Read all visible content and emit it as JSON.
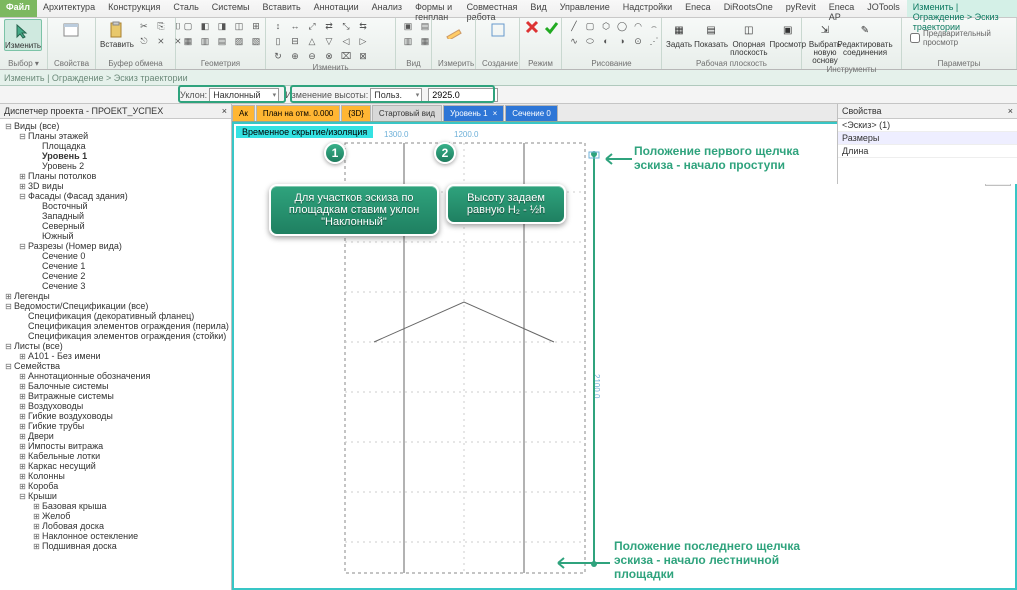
{
  "tabs": {
    "file": "Файл",
    "list": [
      "Архитектура",
      "Конструкция",
      "Сталь",
      "Системы",
      "Вставить",
      "Аннотации",
      "Анализ",
      "Формы и генплан",
      "Совместная работа",
      "Вид",
      "Управление",
      "Надстройки",
      "Eneca",
      "DiRootsOne",
      "pyRevit",
      "Eneca AP",
      "JOTools"
    ],
    "active": "Изменить | Ограждение > Эскиз траектории"
  },
  "ribbon": {
    "select": "Выбор ▾",
    "modify": "Изменить",
    "properties": "Свойства",
    "clipboard": "Буфер обмена",
    "paste": "Вставить",
    "geometry": "Геометрия",
    "modify_panel": "Изменить",
    "view": "Вид",
    "measure": "Измерить",
    "create": "Создание",
    "mode_panel": "Режим",
    "draw": "Рисование",
    "workplane": "Рабочая плоскость",
    "tools": "Инструменты",
    "options": "Параметры",
    "set": "Задать",
    "show": "Показать",
    "refplane": "Опорная плоскость",
    "viewer": "Просмотр",
    "pickhost": "Выбрать новую основу",
    "edit": "Редактировать соединения",
    "preview_chk": "Предварительный просмотр"
  },
  "optbar": {
    "text": "Изменить | Ограждение > Эскиз траектории"
  },
  "optbar2": {
    "slope_lbl": "Уклон:",
    "slope_val": "Наклонный",
    "height_lbl": "Изменение высоты:",
    "height_val": "Польз.",
    "height_num": "2925.0"
  },
  "browser": {
    "title": "Диспетчер проекта - ПРОЕКТ_УСПЕХ",
    "close": "×",
    "items": [
      {
        "d": 0,
        "t": "⊟",
        "l": "Виды (все)",
        "ic": "v"
      },
      {
        "d": 1,
        "t": "⊟",
        "l": "Планы этажей"
      },
      {
        "d": 2,
        "t": "",
        "l": "Площадка"
      },
      {
        "d": 2,
        "t": "",
        "l": "Уровень 1",
        "b": 1
      },
      {
        "d": 2,
        "t": "",
        "l": "Уровень 2"
      },
      {
        "d": 1,
        "t": "⊞",
        "l": "Планы потолков"
      },
      {
        "d": 1,
        "t": "⊞",
        "l": "3D виды"
      },
      {
        "d": 1,
        "t": "⊟",
        "l": "Фасады (Фасад здания)"
      },
      {
        "d": 2,
        "t": "",
        "l": "Восточный"
      },
      {
        "d": 2,
        "t": "",
        "l": "Западный"
      },
      {
        "d": 2,
        "t": "",
        "l": "Северный"
      },
      {
        "d": 2,
        "t": "",
        "l": "Южный"
      },
      {
        "d": 1,
        "t": "⊟",
        "l": "Разрезы (Номер вида)"
      },
      {
        "d": 2,
        "t": "",
        "l": "Сечение 0"
      },
      {
        "d": 2,
        "t": "",
        "l": "Сечение 1"
      },
      {
        "d": 2,
        "t": "",
        "l": "Сечение 2"
      },
      {
        "d": 2,
        "t": "",
        "l": "Сечение 3"
      },
      {
        "d": 0,
        "t": "⊞",
        "l": "Легенды",
        "ic": "l"
      },
      {
        "d": 0,
        "t": "⊟",
        "l": "Ведомости/Спецификации (все)",
        "ic": "s"
      },
      {
        "d": 1,
        "t": "",
        "l": "Спецификация (декоративный фланец)"
      },
      {
        "d": 1,
        "t": "",
        "l": "Спецификация элементов ограждения (перила)"
      },
      {
        "d": 1,
        "t": "",
        "l": "Спецификация элементов ограждения (стойки)"
      },
      {
        "d": 0,
        "t": "⊟",
        "l": "Листы (все)",
        "ic": "sh"
      },
      {
        "d": 1,
        "t": "⊞",
        "l": "A101 - Без имени"
      },
      {
        "d": 0,
        "t": "⊟",
        "l": "Семейства",
        "ic": "f"
      },
      {
        "d": 1,
        "t": "⊞",
        "l": "Аннотационные обозначения"
      },
      {
        "d": 1,
        "t": "⊞",
        "l": "Балочные системы"
      },
      {
        "d": 1,
        "t": "⊞",
        "l": "Витражные системы"
      },
      {
        "d": 1,
        "t": "⊞",
        "l": "Воздуховоды"
      },
      {
        "d": 1,
        "t": "⊞",
        "l": "Гибкие воздуховоды"
      },
      {
        "d": 1,
        "t": "⊞",
        "l": "Гибкие трубы"
      },
      {
        "d": 1,
        "t": "⊞",
        "l": "Двери"
      },
      {
        "d": 1,
        "t": "⊞",
        "l": "Импосты витража"
      },
      {
        "d": 1,
        "t": "⊞",
        "l": "Кабельные лотки"
      },
      {
        "d": 1,
        "t": "⊞",
        "l": "Каркас несущий"
      },
      {
        "d": 1,
        "t": "⊞",
        "l": "Колонны"
      },
      {
        "d": 1,
        "t": "⊞",
        "l": "Короба"
      },
      {
        "d": 1,
        "t": "⊟",
        "l": "Крыши"
      },
      {
        "d": 2,
        "t": "⊞",
        "l": "Базовая крыша"
      },
      {
        "d": 2,
        "t": "⊞",
        "l": "Желоб"
      },
      {
        "d": 2,
        "t": "⊞",
        "l": "Лобовая доска"
      },
      {
        "d": 2,
        "t": "⊞",
        "l": "Наклонное остекление"
      },
      {
        "d": 2,
        "t": "⊞",
        "l": "Подшивная доска"
      }
    ]
  },
  "viewtabs": [
    {
      "label": "Ак",
      "cls": "yellow"
    },
    {
      "label": "План на отм. 0.000",
      "cls": "yellow"
    },
    {
      "label": "{3D}",
      "cls": "yellow"
    },
    {
      "label": "Стартовый вид",
      "cls": ""
    },
    {
      "label": "Уровень 1",
      "cls": "blue",
      "x": "×"
    },
    {
      "label": "Сечение 0",
      "cls": "blue",
      "x": ""
    }
  ],
  "mode_banner": "Временное скрытие/изоляция",
  "dims": {
    "top1": "1300.0",
    "top2": "1200.0",
    "side": "2100.0"
  },
  "annotations": {
    "c1": "Для участков эскиза по площадкам ставим уклон \"Наклонный\"",
    "c2": "Высоту задаем равную H₂ - ½h",
    "t1": "Положение первого щелчка эскиза - начало проступи",
    "t2": "Положение последнего щелчка эскиза - начало лестничной площадки",
    "m1": "1",
    "m2": "2"
  },
  "properties": {
    "title": "Свойства",
    "type": "<Эскиз> (1)",
    "cat": "Размеры",
    "len": "Длина"
  },
  "accent": "#2fa37d"
}
